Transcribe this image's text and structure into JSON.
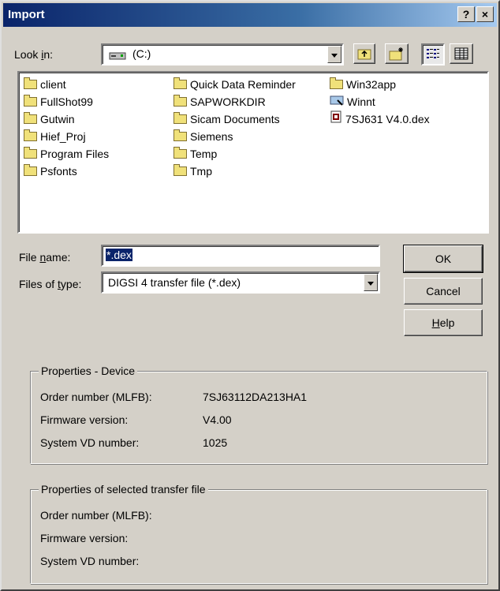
{
  "window": {
    "title": "Import",
    "help_button": "?",
    "close_button": "×"
  },
  "look_in": {
    "label_pre": "Look ",
    "label_u": "i",
    "label_post": "n:",
    "value": "(C:)"
  },
  "files": [
    {
      "name": "client",
      "icon": "folder-icon"
    },
    {
      "name": "FullShot99",
      "icon": "folder-icon"
    },
    {
      "name": "Gutwin",
      "icon": "folder-icon"
    },
    {
      "name": "Hief_Proj",
      "icon": "folder-icon"
    },
    {
      "name": "Program Files",
      "icon": "folder-icon"
    },
    {
      "name": "Psfonts",
      "icon": "folder-icon"
    },
    {
      "name": "Quick Data Reminder",
      "icon": "folder-icon"
    },
    {
      "name": "SAPWORKDIR",
      "icon": "folder-icon"
    },
    {
      "name": "Sicam Documents",
      "icon": "folder-icon"
    },
    {
      "name": "Siemens",
      "icon": "folder-icon"
    },
    {
      "name": "Temp",
      "icon": "folder-icon"
    },
    {
      "name": "Tmp",
      "icon": "folder-icon"
    },
    {
      "name": "Win32app",
      "icon": "folder-icon"
    },
    {
      "name": "Winnt",
      "icon": "system-folder-icon"
    },
    {
      "name": "7SJ631 V4.0.dex",
      "icon": "dex-file-icon"
    }
  ],
  "file_name": {
    "label_pre": "File ",
    "label_u": "n",
    "label_post": "ame:",
    "value": "*.dex"
  },
  "file_type": {
    "label_pre": "Files of ",
    "label_u": "t",
    "label_post": "ype:",
    "value": "DIGSI 4 transfer file (*.dex)"
  },
  "buttons": {
    "ok": "OK",
    "cancel": "Cancel",
    "help_u": "H",
    "help_rest": "elp"
  },
  "device_props": {
    "legend": "Properties - Device",
    "rows": [
      {
        "label": "Order number (MLFB):",
        "value": "7SJ63112DA213HA1"
      },
      {
        "label": "Firmware version:",
        "value": "V4.00"
      },
      {
        "label": "System VD number:",
        "value": "1025"
      }
    ]
  },
  "file_props": {
    "legend": "Properties of selected transfer file",
    "rows": [
      {
        "label": "Order number (MLFB):",
        "value": ""
      },
      {
        "label": "Firmware version:",
        "value": ""
      },
      {
        "label": "System VD number:",
        "value": ""
      }
    ]
  },
  "colors": {
    "title_bar": "#0a246a",
    "selection": "#0a246a",
    "face": "#d4d0c8"
  }
}
